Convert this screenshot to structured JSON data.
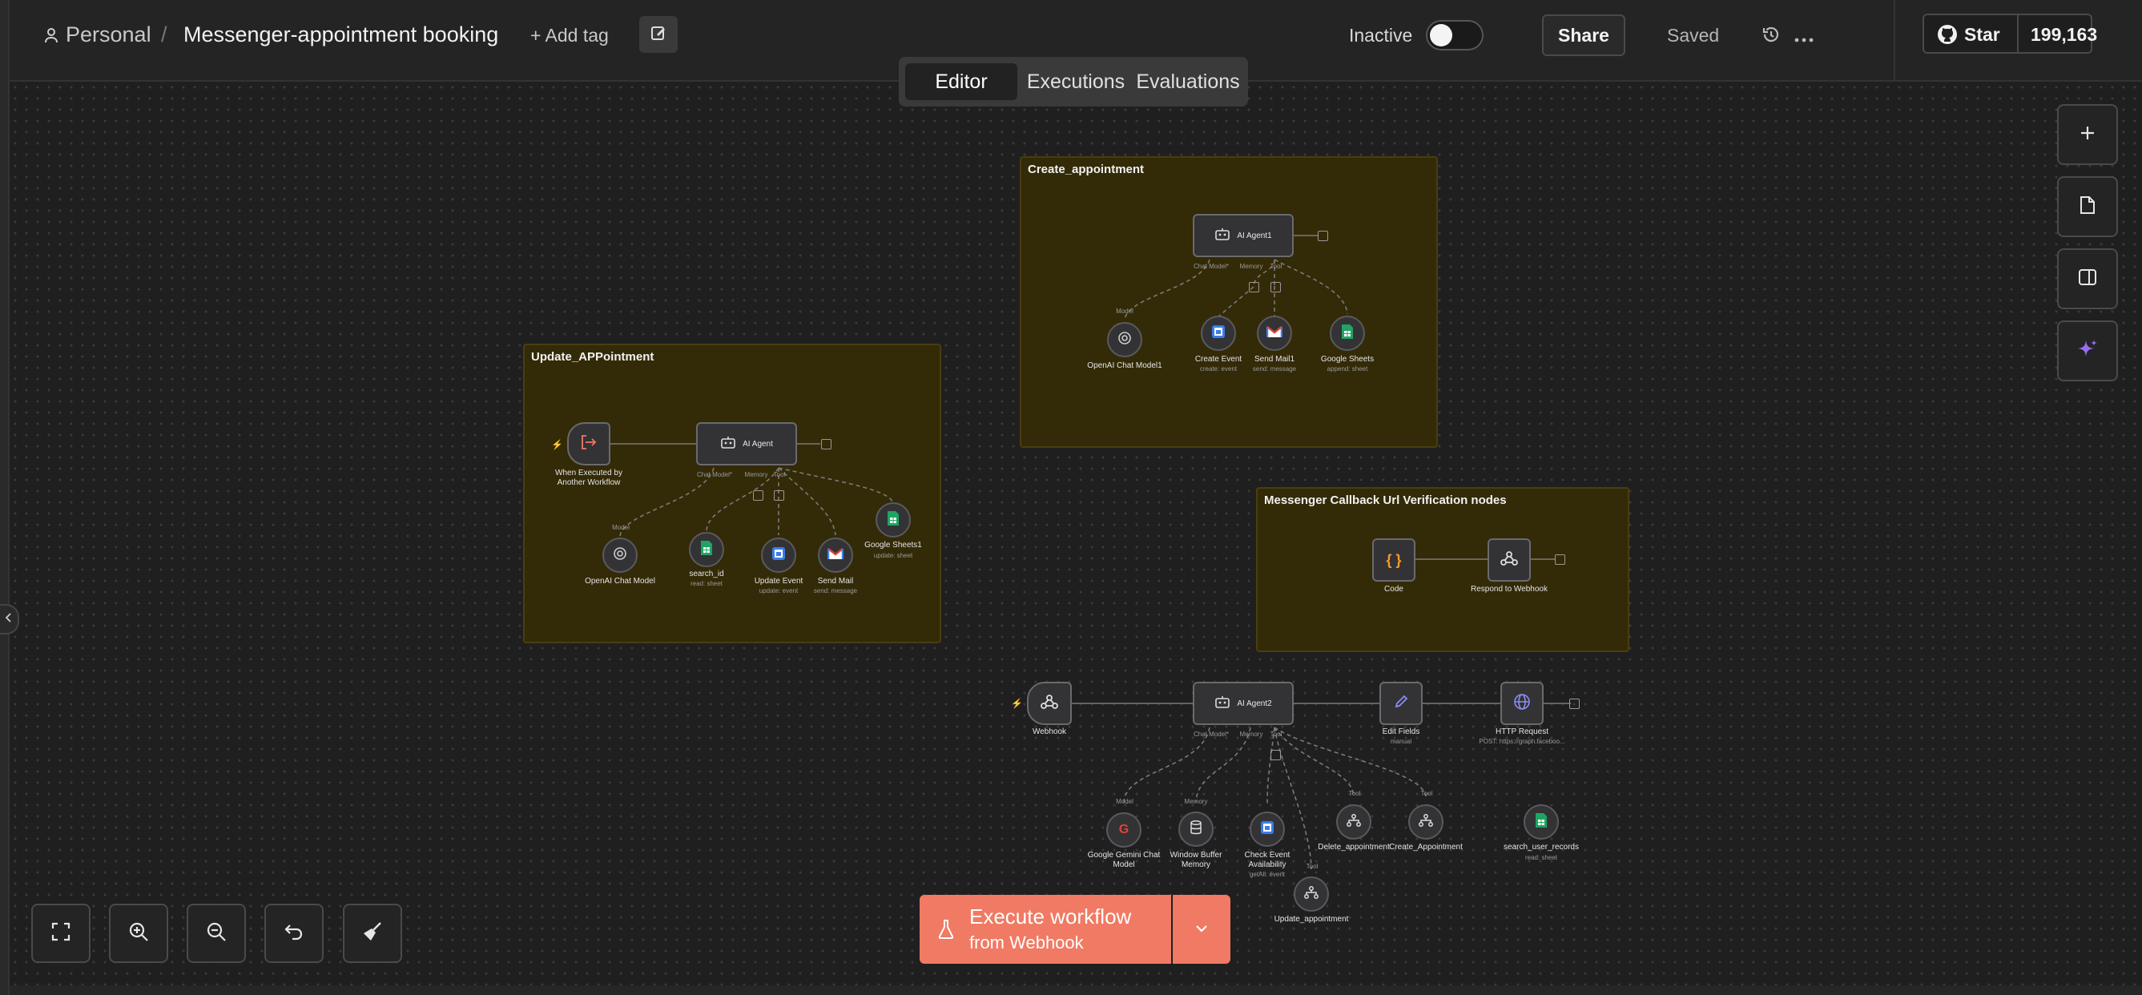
{
  "header": {
    "workspace": "Personal",
    "separator": "/",
    "workflow_name": "Messenger-appointment booking",
    "add_tag": "+ Add tag",
    "status_label": "Inactive",
    "share_label": "Share",
    "saved_label": "Saved",
    "star_label": "Star",
    "star_count": "199,163"
  },
  "tabs": [
    "Editor",
    "Executions",
    "Evaluations"
  ],
  "active_tab": "Editor",
  "groups": {
    "create": "Create_appointment",
    "update": "Update_APPointment",
    "messenger": "Messenger Callback Url Verification nodes"
  },
  "nodes": {
    "ai_agent1": "AI Agent1",
    "openai1": "OpenAI Chat Model1",
    "create_event": "Create Event",
    "create_event_sub": "create: event",
    "send_mail1": "Send Mail1",
    "send_mail1_sub": "send: message",
    "gsheets": "Google Sheets",
    "gsheets_sub": "append: sheet",
    "exec_trigger": "When Executed by Another Workflow",
    "ai_agent": "AI Agent",
    "openai": "OpenAI Chat Model",
    "search_id": "search_id",
    "search_id_sub": "read: sheet",
    "update_event": "Update Event",
    "update_event_sub": "update: event",
    "send_mail": "Send Mail",
    "send_mail_sub": "send: message",
    "gsheets1": "Google Sheets1",
    "gsheets1_sub": "update: sheet",
    "code": "Code",
    "respond": "Respond to Webhook",
    "webhook": "Webhook",
    "ai_agent2": "AI Agent2",
    "edit_fields": "Edit Fields",
    "edit_fields_sub": "manual",
    "http": "HTTP Request",
    "http_sub": "POST: https://graph.faceboo...",
    "gemini": "Google Gemini Chat Model",
    "window_buffer": "Window Buffer Memory",
    "check_event": "Check Event Availability",
    "check_event_sub": "getAll: event",
    "delete_appt": "Delete_appointment",
    "create_appt": "Create_Appointment",
    "search_user": "search_user_records",
    "search_user_sub": "read: sheet",
    "update_appt": "Update_appointment"
  },
  "port_labels": {
    "chat_model": "Chat Model*",
    "memory": "Memory",
    "tool": "Tool",
    "model": "Model"
  },
  "execute": {
    "title": "Execute workflow",
    "subtitle": "from Webhook"
  },
  "colors": {
    "accent": "#f07a63",
    "group_bg": "#332a07",
    "canvas_bg": "#1f1f1f"
  }
}
